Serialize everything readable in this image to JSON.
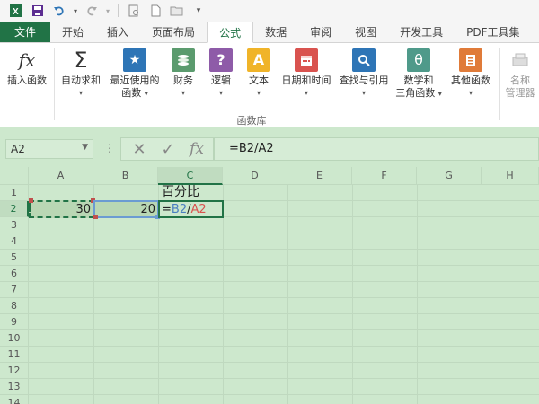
{
  "qat": {
    "icons": [
      "excel-logo-icon",
      "save-icon",
      "undo-icon",
      "redo-icon",
      "print-preview-icon",
      "new-file-icon",
      "open-folder-icon",
      "customize-icon"
    ]
  },
  "tabs": [
    {
      "label": "文件",
      "type": "file"
    },
    {
      "label": "开始"
    },
    {
      "label": "插入"
    },
    {
      "label": "页面布局"
    },
    {
      "label": "公式",
      "active": true
    },
    {
      "label": "数据"
    },
    {
      "label": "审阅"
    },
    {
      "label": "视图"
    },
    {
      "label": "开发工具"
    },
    {
      "label": "PDF工具集"
    }
  ],
  "ribbon": {
    "insert_function": {
      "glyph": "fx",
      "label": "插入函数"
    },
    "autosum": {
      "glyph": "Σ",
      "label": "自动求和"
    },
    "recent": {
      "line1": "最近使用的",
      "line2": "函数"
    },
    "financial": {
      "label": "财务"
    },
    "logical": {
      "glyph": "?",
      "label": "逻辑"
    },
    "text": {
      "glyph": "A",
      "label": "文本"
    },
    "datetime": {
      "label": "日期和时间"
    },
    "lookup": {
      "label": "查找与引用"
    },
    "math": {
      "glyph": "θ",
      "line1": "数学和",
      "line2": "三角函数"
    },
    "more": {
      "label": "其他函数"
    },
    "name_manager": {
      "line1": "名称",
      "line2": "管理器"
    },
    "group_label": "函数库",
    "colors": {
      "fx": "#333333",
      "sigma": "#333333",
      "star": "#2e75b6",
      "finance": "#5b9b6e",
      "logic": "#8e5ba8",
      "text": "#f0b429",
      "date": "#d9534f",
      "lookup": "#2e75b6",
      "math": "#4f9a8a",
      "more": "#e07b39"
    }
  },
  "formula_bar": {
    "name_box": "A2",
    "cancel_glyph": "✕",
    "enter_glyph": "✓",
    "fx_glyph": "fx",
    "formula": "=B2/A2"
  },
  "sheet": {
    "columns": [
      "A",
      "B",
      "C",
      "D",
      "E",
      "F",
      "G",
      "H"
    ],
    "rows": [
      "1",
      "2",
      "3",
      "4",
      "5",
      "6",
      "7",
      "8",
      "9",
      "10",
      "11",
      "12",
      "13",
      "14"
    ],
    "C1": "百分比",
    "A2": "30",
    "B2": "20",
    "C2": {
      "eq": "=",
      "ref1": "B2",
      "op": "/",
      "ref2": "A2"
    },
    "colors": {
      "ref1": "#4a7fc1",
      "ref2": "#d9534f",
      "accent": "#217346"
    }
  }
}
